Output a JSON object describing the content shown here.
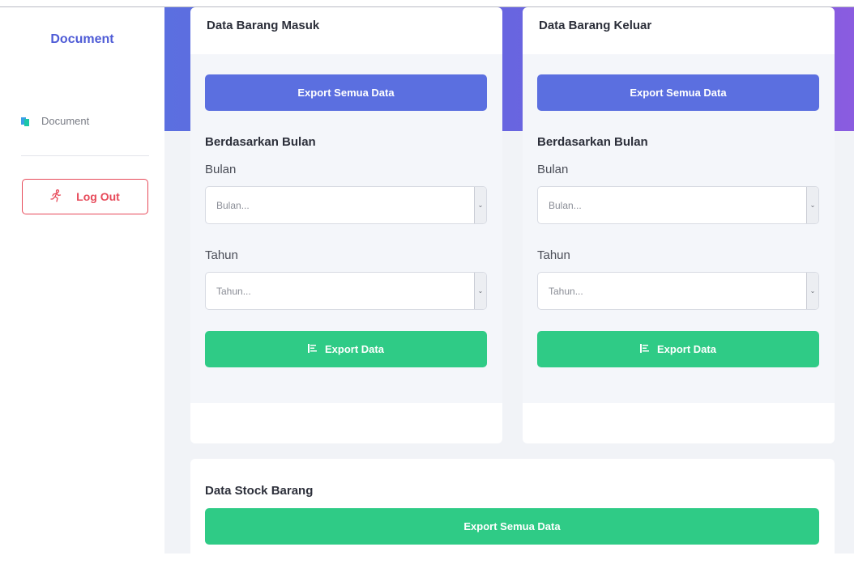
{
  "sidebar": {
    "brand": "Document",
    "nav_items": [
      {
        "label": "Document",
        "icon": "document-icon"
      }
    ],
    "logout_label": "Log Out",
    "logout_icon": "running-person-icon"
  },
  "masuk": {
    "title": "Data Barang Masuk",
    "export_all_label": "Export Semua Data",
    "section_title": "Berdasarkan Bulan",
    "bulan_label": "Bulan",
    "bulan_placeholder": "Bulan...",
    "tahun_label": "Tahun",
    "tahun_placeholder": "Tahun...",
    "export_label": "Export Data"
  },
  "keluar": {
    "title": "Data Barang Keluar",
    "export_all_label": "Export Semua Data",
    "section_title": "Berdasarkan Bulan",
    "bulan_label": "Bulan",
    "bulan_placeholder": "Bulan...",
    "tahun_label": "Tahun",
    "tahun_placeholder": "Tahun...",
    "export_label": "Export Data"
  },
  "stock": {
    "title": "Data Stock Barang",
    "export_all_label": "Export Semua Data"
  },
  "colors": {
    "primary": "#5b6fe0",
    "success": "#2fcb86",
    "danger": "#e74a5a",
    "brand_text": "#4e5bd6"
  }
}
